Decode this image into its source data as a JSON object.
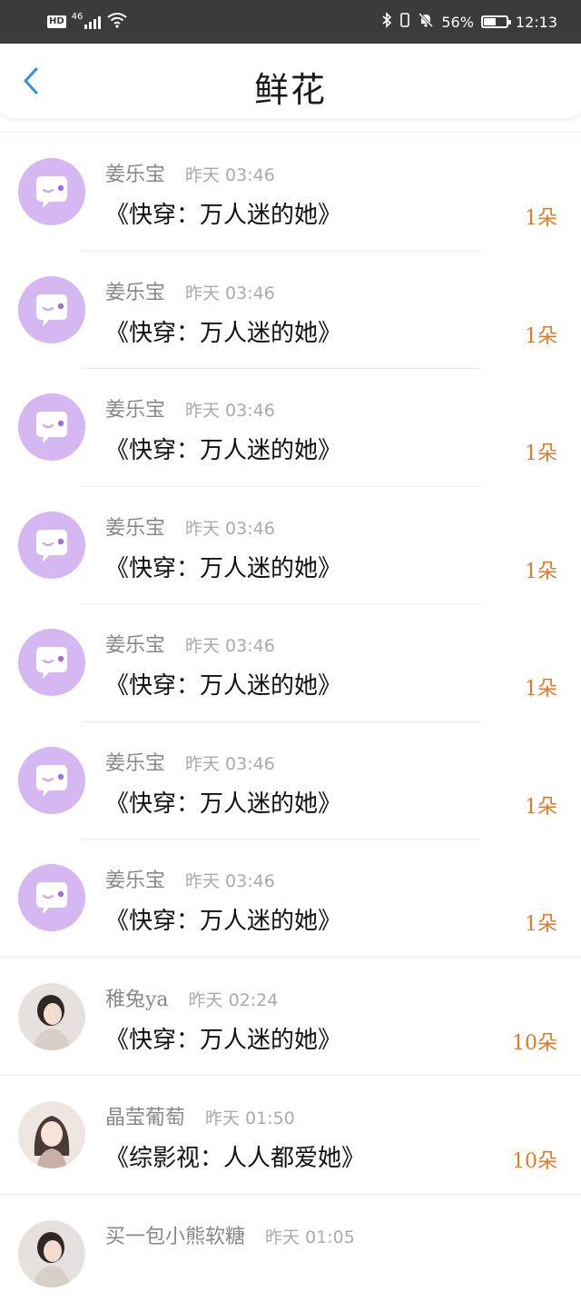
{
  "status_bar": {
    "hd": "HD",
    "network": "46",
    "battery_percent": "56%",
    "battery_level": 0.56,
    "time": "12:13"
  },
  "header": {
    "title": "鲜花"
  },
  "colors": {
    "accent_back": "#2f8fe8",
    "amount": "#e07a2a",
    "default_avatar": "#d5b8f2"
  },
  "gifts": [
    {
      "user": "姜乐宝",
      "time": "昨天 03:46",
      "book": "《快穿：万人迷的她》",
      "amount": "1朵",
      "avatar": "default-avatar-icon"
    },
    {
      "user": "姜乐宝",
      "time": "昨天 03:46",
      "book": "《快穿：万人迷的她》",
      "amount": "1朵",
      "avatar": "default-avatar-icon"
    },
    {
      "user": "姜乐宝",
      "time": "昨天 03:46",
      "book": "《快穿：万人迷的她》",
      "amount": "1朵",
      "avatar": "default-avatar-icon"
    },
    {
      "user": "姜乐宝",
      "time": "昨天 03:46",
      "book": "《快穿：万人迷的她》",
      "amount": "1朵",
      "avatar": "default-avatar-icon"
    },
    {
      "user": "姜乐宝",
      "time": "昨天 03:46",
      "book": "《快穿：万人迷的她》",
      "amount": "1朵",
      "avatar": "default-avatar-icon"
    },
    {
      "user": "姜乐宝",
      "time": "昨天 03:46",
      "book": "《快穿：万人迷的她》",
      "amount": "1朵",
      "avatar": "default-avatar-icon"
    },
    {
      "user": "姜乐宝",
      "time": "昨天 03:46",
      "book": "《快穿：万人迷的她》",
      "amount": "1朵",
      "avatar": "default-avatar-icon"
    },
    {
      "user": "稚兔ya",
      "time": "昨天 02:24",
      "book": "《快穿：万人迷的她》",
      "amount": "10朵",
      "avatar": "photo-avatar-icon"
    },
    {
      "user": "晶莹葡萄",
      "time": "昨天 01:50",
      "book": "《综影视：人人都爱她》",
      "amount": "10朵",
      "avatar": "illustration-avatar-icon"
    },
    {
      "user": "买一包小熊软糖",
      "time": "昨天 01:05",
      "book": "",
      "amount": "",
      "avatar": "photo-avatar-icon"
    }
  ]
}
